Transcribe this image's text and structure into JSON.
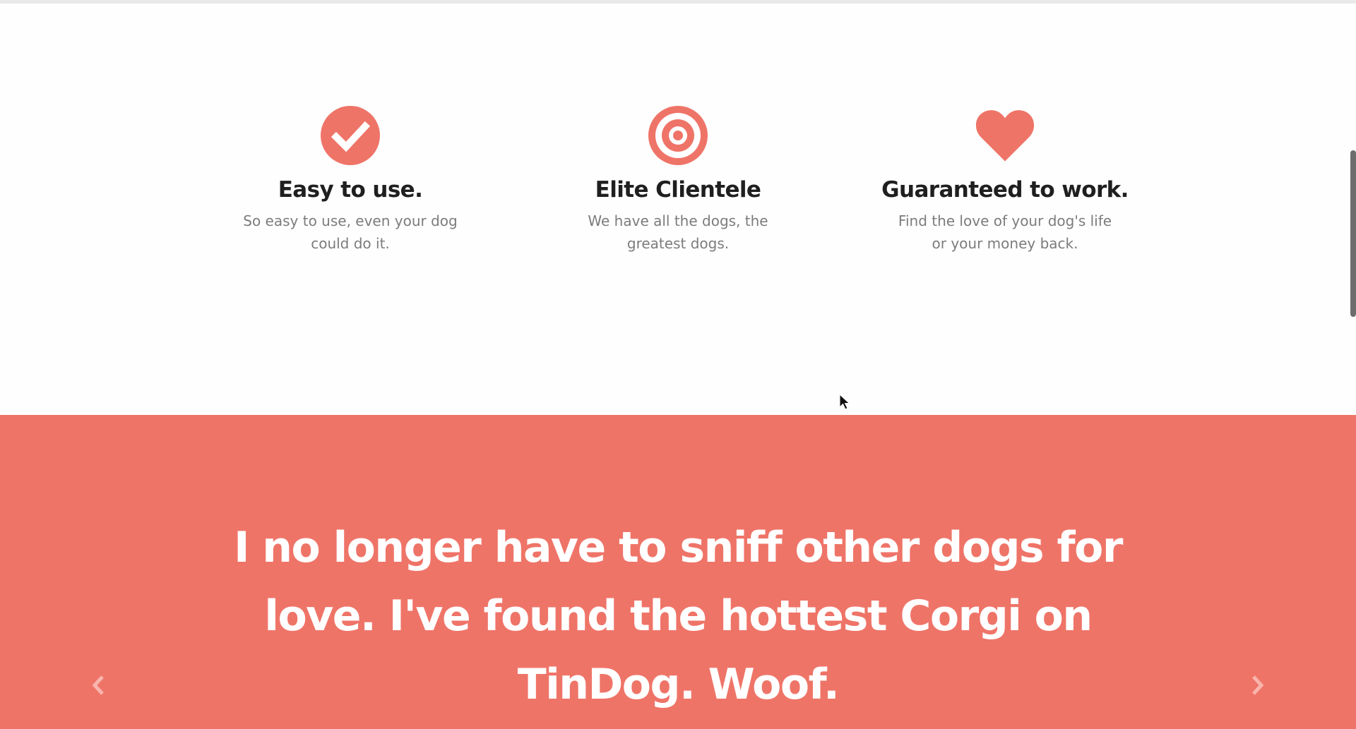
{
  "features": [
    {
      "icon": "check-circle-icon",
      "title": "Easy to use.",
      "description": "So easy to use, even your dog could do it."
    },
    {
      "icon": "bullseye-icon",
      "title": "Elite Clientele",
      "description": "We have all the dogs, the greatest dogs."
    },
    {
      "icon": "heart-icon",
      "title": "Guaranteed to work.",
      "description": "Find the love of your dog's life or your money back."
    }
  ],
  "testimonial": {
    "quote": "I no longer have to sniff other dogs for love. I've found the hottest Corgi on TinDog. Woof.",
    "prev_icon": "chevron-left-icon",
    "next_icon": "chevron-right-icon"
  },
  "colors": {
    "accent": "#ef7468",
    "heading": "#1f1f1f",
    "body_text": "#7c7c7c",
    "background": "#ffffff"
  }
}
